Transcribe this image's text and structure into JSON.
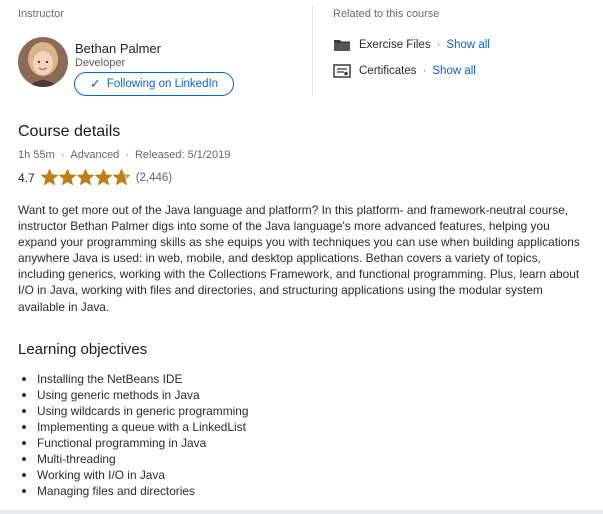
{
  "instructor": {
    "label": "Instructor",
    "name": "Bethan Palmer",
    "title": "Developer",
    "follow_label": "Following on LinkedIn"
  },
  "related": {
    "label": "Related to this course",
    "items": [
      {
        "label": "Exercise Files",
        "link": "Show all",
        "icon": "folder-icon"
      },
      {
        "label": "Certificates",
        "link": "Show all",
        "icon": "certificate-icon"
      }
    ]
  },
  "course": {
    "title": "Course details",
    "duration": "1h 55m",
    "level": "Advanced",
    "released": "Released: 5/1/2019",
    "rating_value": "4.7",
    "rating_count": "(2,446)",
    "stars": 4.7,
    "description": "Want to get more out of the Java language and platform? In this platform- and framework-neutral course, instructor Bethan Palmer digs into some of the Java language's more advanced features, helping you expand your programming skills as she equips you with techniques you can use when building applications anywhere Java is used: in web, mobile, and desktop applications. Bethan covers a variety of topics, including generics, working with the Collections Framework, and functional programming. Plus, learn about I/O in Java, working with files and directories, and structuring applications using the modular system available in Java."
  },
  "objectives": {
    "title": "Learning objectives",
    "items": [
      "Installing the NetBeans IDE",
      "Using generic methods in Java",
      "Using wildcards in generic programming",
      "Implementing a queue with a LinkedList",
      "Functional programming in Java",
      "Multi-threading",
      "Working with I/O in Java",
      "Managing files and directories"
    ]
  },
  "colors": {
    "accent": "#0a66c2",
    "star": "#c37d16"
  }
}
